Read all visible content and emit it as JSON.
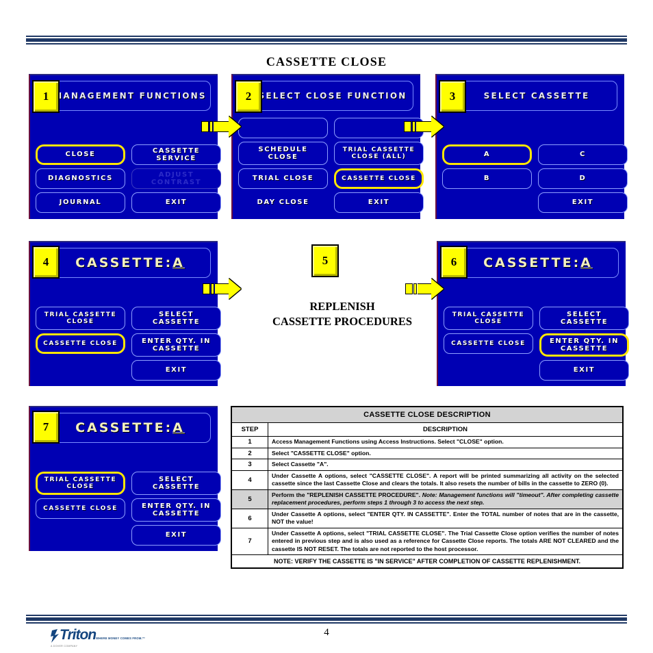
{
  "document": {
    "title": "CASSETTE CLOSE",
    "page_number": "4",
    "center_note_line1": "REPLENISH",
    "center_note_line2": "CASSETTE PROCEDURES",
    "logo_word": "Triton",
    "logo_tagline": "WHERE MONEY COMES FROM.™",
    "logo_sub": "A DOVER COMPANY"
  },
  "screens": [
    {
      "step": "1",
      "header": "MANAGEMENT FUNCTIONS",
      "header_style": "plain",
      "buttons": [
        {
          "label": "CLOSE",
          "highlight": true,
          "state": "normal"
        },
        {
          "label": "CASSETTE\nSERVICE",
          "highlight": false,
          "state": "normal"
        },
        {
          "label": "DIAGNOSTICS",
          "highlight": false,
          "state": "normal"
        },
        {
          "label": "ADJUST\nCONTRAST",
          "highlight": false,
          "state": "dim"
        },
        {
          "label": "JOURNAL",
          "highlight": false,
          "state": "normal"
        },
        {
          "label": "EXIT",
          "highlight": false,
          "state": "normal"
        }
      ]
    },
    {
      "step": "2",
      "header": "SELECT CLOSE FUNCTION",
      "header_style": "plain",
      "buttons": [
        {
          "label": "",
          "highlight": false,
          "state": "empty"
        },
        {
          "label": "",
          "highlight": false,
          "state": "empty"
        },
        {
          "label": "SCHEDULE\nCLOSE",
          "highlight": false,
          "state": "normal"
        },
        {
          "label": "TRIAL CASSETTE\nCLOSE (ALL)",
          "highlight": false,
          "state": "normal"
        },
        {
          "label": "TRIAL CLOSE",
          "highlight": false,
          "state": "normal"
        },
        {
          "label": "CASSETTE CLOSE",
          "highlight": true,
          "state": "normal"
        },
        {
          "label": "DAY CLOSE",
          "highlight": false,
          "state": "noborder"
        },
        {
          "label": "EXIT",
          "highlight": false,
          "state": "normal"
        }
      ]
    },
    {
      "step": "3",
      "header": "SELECT CASSETTE",
      "header_style": "plain",
      "buttons": [
        {
          "label": "A",
          "highlight": true,
          "state": "normal"
        },
        {
          "label": "C",
          "highlight": false,
          "state": "normal"
        },
        {
          "label": "B",
          "highlight": false,
          "state": "normal"
        },
        {
          "label": "D",
          "highlight": false,
          "state": "normal"
        },
        {
          "label": "EXIT",
          "highlight": false,
          "state": "normal"
        }
      ]
    },
    {
      "step": "4",
      "header": "CASSETTE:A",
      "header_style": "cassette",
      "buttons": [
        {
          "label": "TRIAL CASSETTE\nCLOSE",
          "highlight": false,
          "state": "normal"
        },
        {
          "label": "SELECT\nCASSETTE",
          "highlight": false,
          "state": "normal"
        },
        {
          "label": "CASSETTE CLOSE",
          "highlight": true,
          "state": "normal"
        },
        {
          "label": "ENTER QTY. IN\nCASSETTE",
          "highlight": false,
          "state": "normal"
        },
        {
          "label": "EXIT",
          "highlight": false,
          "state": "normal"
        }
      ]
    },
    {
      "step": "6",
      "header": "CASSETTE:A",
      "header_style": "cassette",
      "buttons": [
        {
          "label": "TRIAL CASSETTE\nCLOSE",
          "highlight": false,
          "state": "normal"
        },
        {
          "label": "SELECT\nCASSETTE",
          "highlight": false,
          "state": "normal"
        },
        {
          "label": "CASSETTE CLOSE",
          "highlight": false,
          "state": "normal"
        },
        {
          "label": "ENTER QTY. IN\nCASSETTE",
          "highlight": true,
          "state": "normal"
        },
        {
          "label": "EXIT",
          "highlight": false,
          "state": "normal"
        }
      ]
    },
    {
      "step": "7",
      "header": "CASSETTE:A",
      "header_style": "cassette",
      "buttons": [
        {
          "label": "TRIAL CASSETTE\nCLOSE",
          "highlight": true,
          "state": "normal"
        },
        {
          "label": "SELECT\nCASSETTE",
          "highlight": false,
          "state": "normal"
        },
        {
          "label": "CASSETTE CLOSE",
          "highlight": false,
          "state": "normal"
        },
        {
          "label": "ENTER QTY. IN\nCASSETTE",
          "highlight": false,
          "state": "normal"
        },
        {
          "label": "EXIT",
          "highlight": false,
          "state": "normal"
        }
      ]
    }
  ],
  "step_badges": [
    "1",
    "2",
    "3",
    "4",
    "5",
    "6",
    "7"
  ],
  "table": {
    "title": "CASSETTE CLOSE DESCRIPTION",
    "columns": [
      "STEP",
      "DESCRIPTION"
    ],
    "rows": [
      {
        "step": "1",
        "description": "Access Management Functions using Access Instructions. Select \"CLOSE\" option.",
        "shaded": false
      },
      {
        "step": "2",
        "description": "Select \"CASSETTE CLOSE\" option.",
        "shaded": false
      },
      {
        "step": "3",
        "description": "Select Cassette \"A\".",
        "shaded": false
      },
      {
        "step": "4",
        "description": "Under Cassette A options, select \"CASSETTE CLOSE\". A report will be printed summarizing all activity on the selected cassette since the last Cassette Close and clears the totals. It also resets the number of bills in the cassette to ZERO (0).",
        "shaded": false
      },
      {
        "step": "5",
        "description": "Perform the \"REPLENISH CASSETTE PROCEDURE\". ",
        "description_italic": "Note: Management functions will \"timeout\".  After completing cassette replacement procedures, perform steps 1 through 3 to access the next step.",
        "shaded": true
      },
      {
        "step": "6",
        "description": "Under Cassette A options, select \"ENTER QTY. IN CASSETTE\". Enter the TOTAL number of notes that are in the cassette, NOT the value!",
        "shaded": false
      },
      {
        "step": "7",
        "description": "Under Cassette A options, select \"TRIAL CASSETTE CLOSE\". The Trial Cassette Close option verifies the number of notes entered in previous step and is also used as a reference for Cassette Close reports. The totals ARE NOT CLEARED and the cassette IS NOT RESET. The totals are not reported to the host processor.",
        "shaded": false
      }
    ],
    "footer_note": "NOTE: VERIFY THE CASSETTE IS \"IN SERVICE\" AFTER COMPLETION OF CASSETTE REPLENISHMENT."
  },
  "colors": {
    "screen_blue": "#0000b3",
    "highlight_yellow": "#ffe600",
    "badge_yellow": "#ffff00",
    "rule_navy": "#1f3864",
    "table_shade": "#d3d3d3",
    "cassette_text": "#f3f0c0"
  }
}
